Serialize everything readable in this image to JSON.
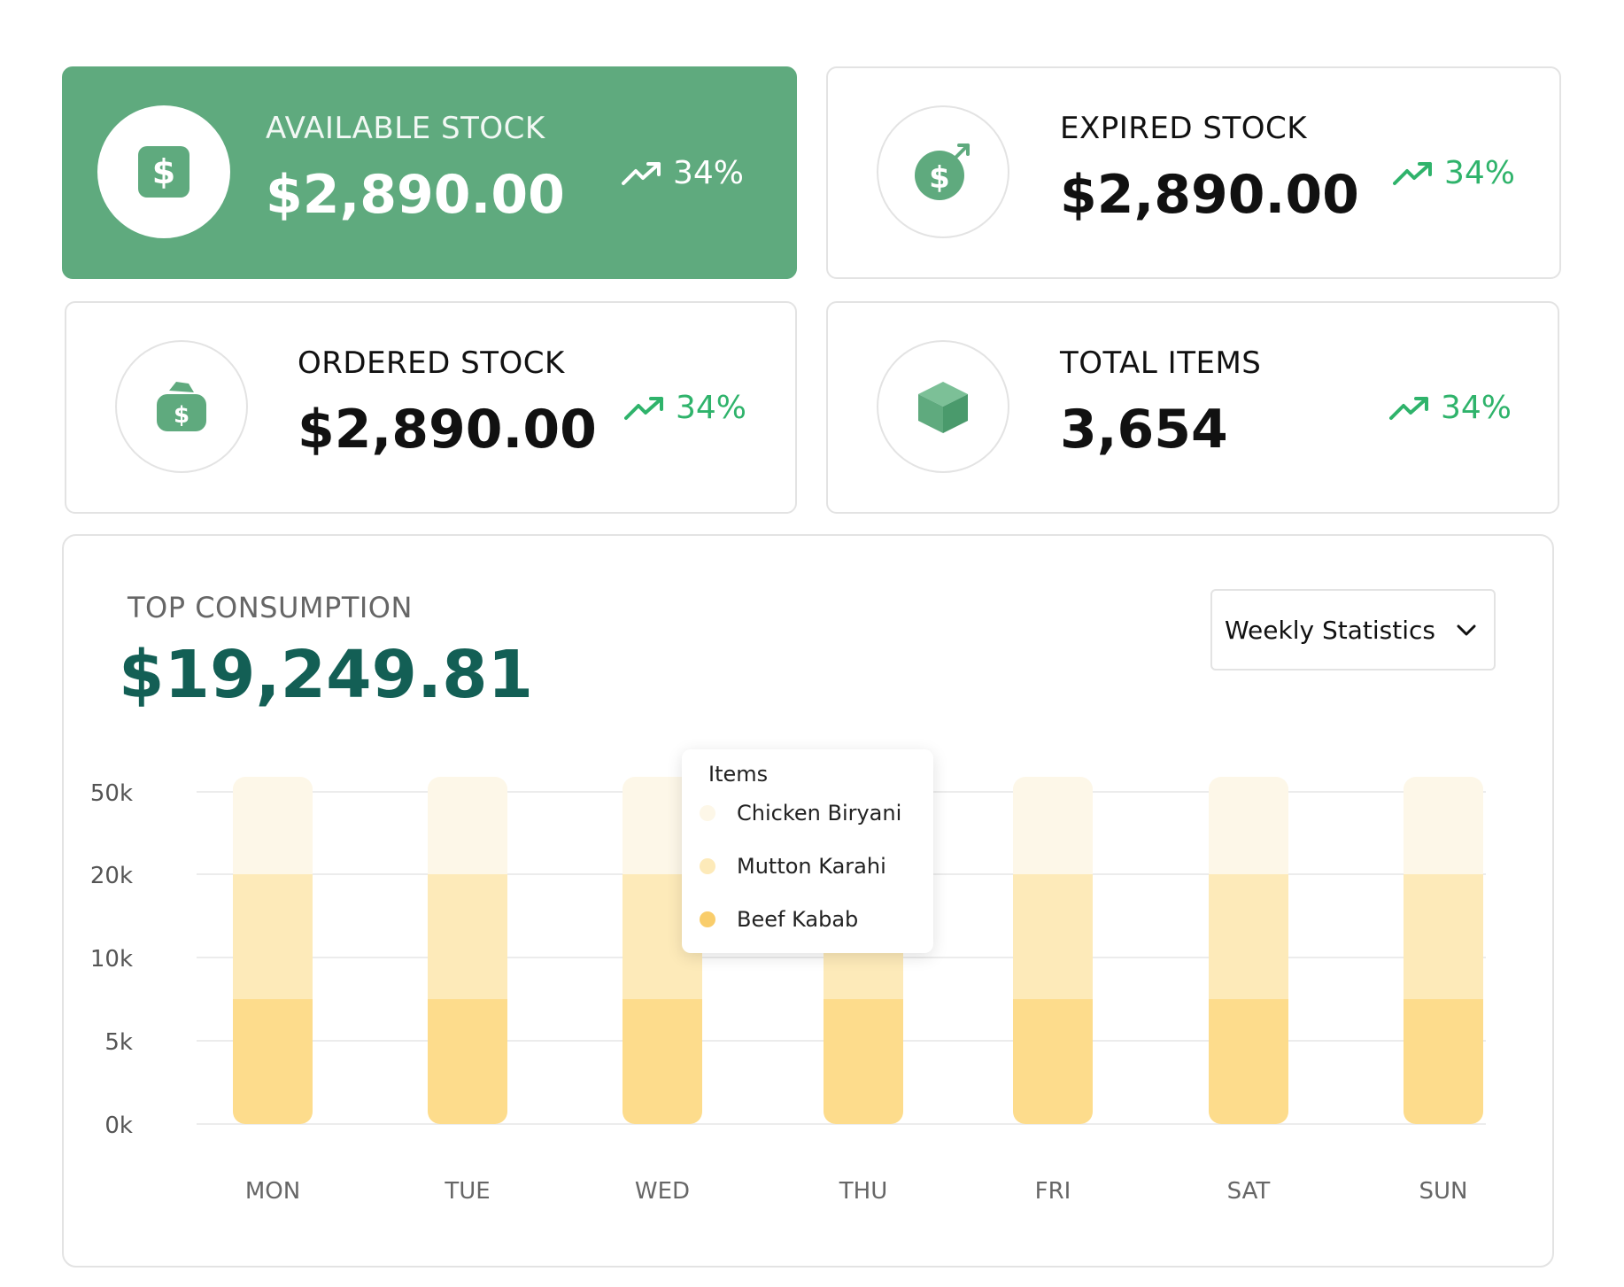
{
  "cards": [
    {
      "label": "AVAILABLE STOCK",
      "value": "$2,890.00",
      "trend": "34%",
      "icon": "dollar-icon"
    },
    {
      "label": "EXPIRED STOCK",
      "value": "$2,890.00",
      "trend": "34%",
      "icon": "dollar-arrow-icon"
    },
    {
      "label": "ORDERED STOCK",
      "value": "$2,890.00",
      "trend": "34%",
      "icon": "money-bag-icon"
    },
    {
      "label": "TOTAL ITEMS",
      "value": "3,654",
      "trend": "34%",
      "icon": "box-icon"
    }
  ],
  "consumption": {
    "label": "TOP CONSUMPTION",
    "value": "$19,249.81",
    "dropdown": "Weekly Statistics"
  },
  "tooltip": {
    "title": "Items",
    "items": [
      "Chicken Biryani",
      "Mutton Karahi",
      "Beef Kabab"
    ]
  },
  "colors": {
    "accent": "#5faa7e",
    "trend": "#2fb36b",
    "total": "#135f55",
    "series": [
      "#fdf7e8",
      "#fdeab9",
      "#fddc8c"
    ]
  },
  "chart_data": {
    "type": "bar",
    "stacked": true,
    "categories": [
      "MON",
      "TUE",
      "WED",
      "THU",
      "FRI",
      "SAT",
      "SUN"
    ],
    "y_ticks": [
      "50k",
      "20k",
      "10k",
      "5k",
      "0k"
    ],
    "y_tick_values": [
      50000,
      20000,
      10000,
      5000,
      0
    ],
    "series": [
      {
        "name": "Beef Kabab",
        "values": [
          7500,
          7500,
          7500,
          7500,
          7500,
          7500,
          7500
        ]
      },
      {
        "name": "Mutton Karahi",
        "values": [
          12500,
          12500,
          12500,
          12500,
          12500,
          12500,
          12500
        ]
      },
      {
        "name": "Chicken Biryani",
        "values": [
          32000,
          32000,
          32000,
          32000,
          32000,
          32000,
          32000
        ]
      }
    ],
    "grid": true
  }
}
